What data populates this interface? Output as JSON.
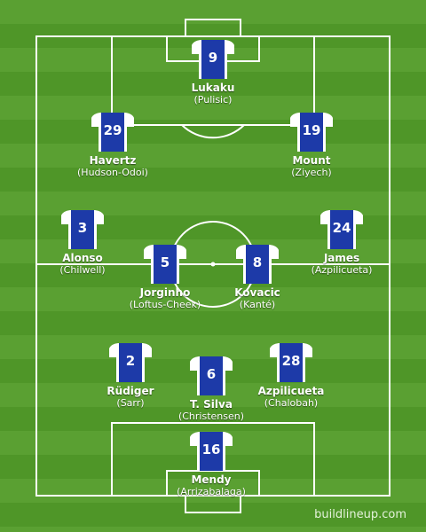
{
  "pitch": {
    "stripe_light": "#5aa032",
    "stripe_dark": "#4f9628",
    "line_color": "#ffffff"
  },
  "kit": {
    "body_color": "#1d3aa8",
    "sleeve_color": "#ffffff",
    "number_color": "#ffffff"
  },
  "players": [
    {
      "number": "9",
      "name": "Lukaku",
      "sub": "(Pulisic)"
    },
    {
      "number": "29",
      "name": "Havertz",
      "sub": "(Hudson-Odoi)"
    },
    {
      "number": "19",
      "name": "Mount",
      "sub": "(Ziyech)"
    },
    {
      "number": "3",
      "name": "Alonso",
      "sub": "(Chilwell)"
    },
    {
      "number": "24",
      "name": "James",
      "sub": "(Azpilicueta)"
    },
    {
      "number": "5",
      "name": "Jorginho",
      "sub": "(Loftus-Cheek)"
    },
    {
      "number": "8",
      "name": "Kovacic",
      "sub": "(Kanté)"
    },
    {
      "number": "2",
      "name": "Rüdiger",
      "sub": "(Sarr)"
    },
    {
      "number": "6",
      "name": "T. Silva",
      "sub": "(Christensen)"
    },
    {
      "number": "28",
      "name": "Azpilicueta",
      "sub": "(Chalobah)"
    },
    {
      "number": "16",
      "name": "Mendy",
      "sub": "(Arrizabalaga)"
    }
  ],
  "watermark": "buildlineup.com"
}
